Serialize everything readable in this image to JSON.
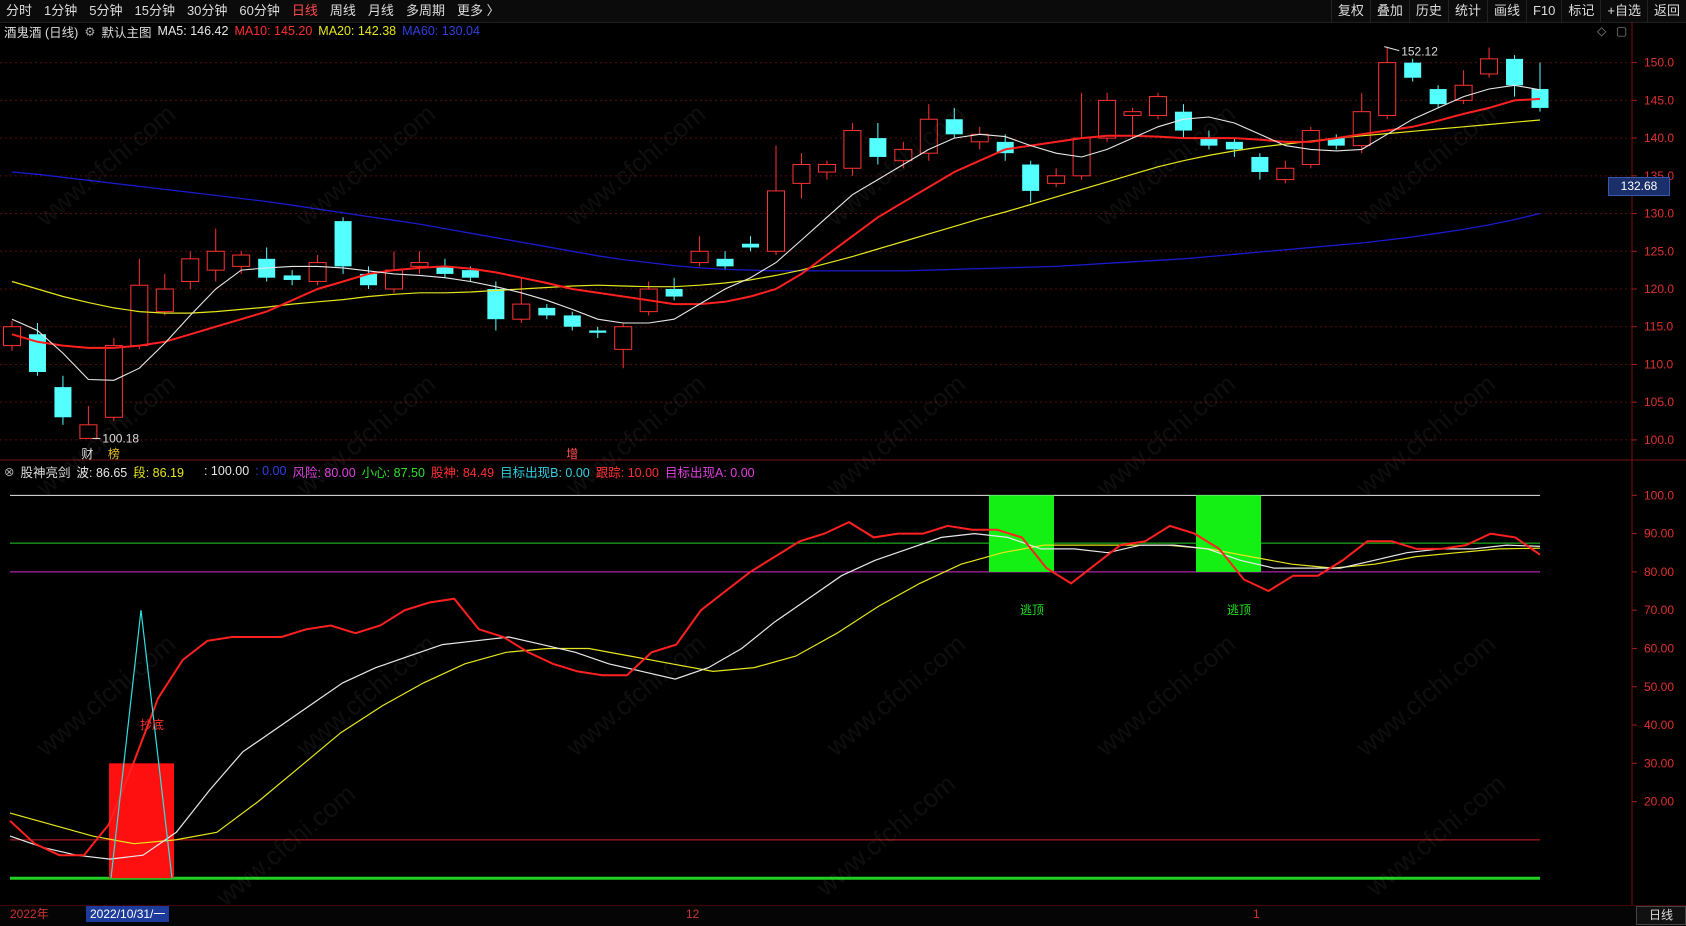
{
  "toolbar": {
    "tabs": [
      "分时",
      "1分钟",
      "5分钟",
      "15分钟",
      "30分钟",
      "60分钟",
      "日线",
      "周线",
      "月线",
      "多周期",
      "更多 〉"
    ],
    "active_tab": "日线",
    "tools": [
      "复权",
      "叠加",
      "历史",
      "统计",
      "画线",
      "F10",
      "标记",
      "+自选",
      "返回"
    ]
  },
  "main_legend": {
    "stock": "酒鬼酒 (日线)",
    "template": "默认主图",
    "ma5": "MA5: 146.42",
    "ma10": "MA10: 145.20",
    "ma20": "MA20: 142.38",
    "ma60": "MA60: 130.04"
  },
  "sub_legend": {
    "name": "股神亮剑",
    "bo": "波: 86.65",
    "duan": "段: 86.19",
    "v100": ": 100.00",
    "v0": ": 0.00",
    "fengxian": "风险: 80.00",
    "xiaoxin": "小心: 87.50",
    "gushen": "股神: 84.49",
    "mubiaoB": "目标出现B: 0.00",
    "genzong": "跟踪: 10.00",
    "mubiaoA": "目标出现A: 0.00"
  },
  "price_axis": [
    "150.0",
    "145.0",
    "140.0",
    "135.0",
    "130.0",
    "125.0",
    "120.0",
    "115.0",
    "110.0",
    "105.0",
    "100.0"
  ],
  "ind_axis": [
    "100.0",
    "90.00",
    "80.00",
    "70.00",
    "60.00",
    "50.00",
    "40.00",
    "30.00",
    "20.00"
  ],
  "current_price": "132.68",
  "high_label": "152.12",
  "low_label": "100.18",
  "markers": {
    "cai": "财",
    "bang": "榜",
    "zeng": "增",
    "chaodi": "抄底",
    "taoding1": "逃顶",
    "taoding2": "逃顶"
  },
  "watermark": "www.cfchi.com",
  "bottom": {
    "year": "2022年",
    "date": "2022/10/31/一",
    "m12": "12",
    "m1": "1",
    "day_button": "日线"
  },
  "colors": {
    "up": "#ff3232",
    "down": "#54ffff",
    "ma5": "#e8e8e8",
    "ma10": "#ff2020",
    "ma20": "#e6e61e",
    "ma60": "#1a1acc"
  },
  "chart_data": {
    "type": "candlestick",
    "title": "酒鬼酒 (日线)",
    "ylim": [
      98,
      153
    ],
    "candles": [
      {
        "o": 112.5,
        "c": 115.0,
        "h": 115.8,
        "l": 111.8
      },
      {
        "o": 114.0,
        "c": 109.0,
        "h": 115.5,
        "l": 108.5
      },
      {
        "o": 107.0,
        "c": 103.0,
        "h": 108.5,
        "l": 102.0
      },
      {
        "o": 100.2,
        "c": 102.0,
        "h": 104.5,
        "l": 100.18
      },
      {
        "o": 103.0,
        "c": 112.5,
        "h": 113.5,
        "l": 102.5
      },
      {
        "o": 112.5,
        "c": 120.5,
        "h": 124.0,
        "l": 112.0
      },
      {
        "o": 117.0,
        "c": 120.0,
        "h": 122.0,
        "l": 116.5
      },
      {
        "o": 121.0,
        "c": 124.0,
        "h": 125.0,
        "l": 120.0
      },
      {
        "o": 122.5,
        "c": 125.0,
        "h": 128.0,
        "l": 121.0
      },
      {
        "o": 123.0,
        "c": 124.5,
        "h": 125.0,
        "l": 122.0
      },
      {
        "o": 124.0,
        "c": 121.5,
        "h": 125.5,
        "l": 121.0
      },
      {
        "o": 121.8,
        "c": 121.2,
        "h": 122.5,
        "l": 120.5
      },
      {
        "o": 121.0,
        "c": 123.5,
        "h": 124.5,
        "l": 120.5
      },
      {
        "o": 129.0,
        "c": 123.0,
        "h": 129.5,
        "l": 122.0
      },
      {
        "o": 122.0,
        "c": 120.5,
        "h": 123.0,
        "l": 120.0
      },
      {
        "o": 120.0,
        "c": 122.5,
        "h": 125.0,
        "l": 119.5
      },
      {
        "o": 123.0,
        "c": 123.5,
        "h": 125.0,
        "l": 122.0
      },
      {
        "o": 123.0,
        "c": 122.0,
        "h": 124.0,
        "l": 121.5
      },
      {
        "o": 122.5,
        "c": 121.5,
        "h": 123.0,
        "l": 121.0
      },
      {
        "o": 120.0,
        "c": 116.0,
        "h": 121.0,
        "l": 114.5
      },
      {
        "o": 116.0,
        "c": 118.0,
        "h": 121.5,
        "l": 115.5
      },
      {
        "o": 117.5,
        "c": 116.5,
        "h": 118.0,
        "l": 116.0
      },
      {
        "o": 116.5,
        "c": 115.0,
        "h": 117.0,
        "l": 114.5
      },
      {
        "o": 114.5,
        "c": 114.2,
        "h": 115.0,
        "l": 113.5
      },
      {
        "o": 112.0,
        "c": 115.0,
        "h": 115.5,
        "l": 109.5
      },
      {
        "o": 117.0,
        "c": 120.0,
        "h": 121.0,
        "l": 116.5
      },
      {
        "o": 120.0,
        "c": 119.0,
        "h": 121.5,
        "l": 118.5
      },
      {
        "o": 123.5,
        "c": 125.0,
        "h": 127.0,
        "l": 123.0
      },
      {
        "o": 124.0,
        "c": 123.0,
        "h": 125.0,
        "l": 122.5
      },
      {
        "o": 126.0,
        "c": 125.5,
        "h": 127.0,
        "l": 125.0
      },
      {
        "o": 125.0,
        "c": 133.0,
        "h": 139.0,
        "l": 124.5
      },
      {
        "o": 134.0,
        "c": 136.5,
        "h": 138.0,
        "l": 132.0
      },
      {
        "o": 135.5,
        "c": 136.5,
        "h": 137.0,
        "l": 134.5
      },
      {
        "o": 136.0,
        "c": 141.0,
        "h": 142.0,
        "l": 135.0
      },
      {
        "o": 140.0,
        "c": 137.5,
        "h": 142.0,
        "l": 136.5
      },
      {
        "o": 137.0,
        "c": 138.5,
        "h": 139.5,
        "l": 136.0
      },
      {
        "o": 138.0,
        "c": 142.5,
        "h": 144.5,
        "l": 137.0
      },
      {
        "o": 142.5,
        "c": 140.5,
        "h": 144.0,
        "l": 140.0
      },
      {
        "o": 139.5,
        "c": 140.5,
        "h": 141.5,
        "l": 138.5
      },
      {
        "o": 139.5,
        "c": 138.0,
        "h": 140.5,
        "l": 137.0
      },
      {
        "o": 136.5,
        "c": 133.0,
        "h": 137.0,
        "l": 131.5
      },
      {
        "o": 134.0,
        "c": 135.0,
        "h": 136.0,
        "l": 133.5
      },
      {
        "o": 135.0,
        "c": 140.0,
        "h": 146.0,
        "l": 134.5
      },
      {
        "o": 140.0,
        "c": 145.0,
        "h": 146.0,
        "l": 139.5
      },
      {
        "o": 143.0,
        "c": 143.5,
        "h": 144.0,
        "l": 140.0
      },
      {
        "o": 143.0,
        "c": 145.5,
        "h": 146.0,
        "l": 142.5
      },
      {
        "o": 143.5,
        "c": 141.0,
        "h": 144.5,
        "l": 140.0
      },
      {
        "o": 140.0,
        "c": 139.0,
        "h": 141.0,
        "l": 138.5
      },
      {
        "o": 139.5,
        "c": 138.5,
        "h": 140.0,
        "l": 137.5
      },
      {
        "o": 137.5,
        "c": 135.5,
        "h": 138.0,
        "l": 134.5
      },
      {
        "o": 134.5,
        "c": 136.0,
        "h": 137.0,
        "l": 134.0
      },
      {
        "o": 136.5,
        "c": 141.0,
        "h": 141.5,
        "l": 136.0
      },
      {
        "o": 140.0,
        "c": 139.0,
        "h": 140.5,
        "l": 138.5
      },
      {
        "o": 139.0,
        "c": 143.5,
        "h": 146.0,
        "l": 138.0
      },
      {
        "o": 143.0,
        "c": 150.0,
        "h": 152.12,
        "l": 142.5
      },
      {
        "o": 150.0,
        "c": 148.0,
        "h": 150.5,
        "l": 147.5
      },
      {
        "o": 146.5,
        "c": 144.5,
        "h": 147.0,
        "l": 144.0
      },
      {
        "o": 145.0,
        "c": 147.0,
        "h": 149.0,
        "l": 144.5
      },
      {
        "o": 148.5,
        "c": 150.5,
        "h": 152.0,
        "l": 148.0
      },
      {
        "o": 150.5,
        "c": 147.0,
        "h": 151.0,
        "l": 145.5
      },
      {
        "o": 146.5,
        "c": 144.0,
        "h": 150.0,
        "l": 143.5
      }
    ],
    "ma5": [
      116.0,
      114.5,
      111.5,
      108.0,
      107.9,
      109.5,
      112.8,
      116.5,
      120.0,
      122.5,
      122.8,
      123.0,
      123.0,
      122.8,
      122.4,
      122.0,
      121.8,
      121.5,
      121.0,
      120.3,
      119.5,
      118.5,
      117.3,
      116.0,
      115.5,
      115.5,
      116.0,
      118.0,
      120.0,
      121.5,
      123.5,
      126.5,
      129.5,
      132.5,
      134.5,
      136.5,
      138.5,
      140.0,
      140.5,
      140.2,
      139.0,
      138.0,
      137.5,
      138.5,
      140.0,
      141.5,
      142.5,
      142.8,
      142.0,
      140.5,
      139.0,
      138.5,
      138.3,
      138.5,
      140.5,
      142.5,
      144.0,
      145.5,
      146.5,
      147.0,
      146.4
    ],
    "ma10": [
      114.0,
      113.0,
      112.5,
      112.2,
      112.2,
      112.5,
      113.0,
      114.0,
      115.0,
      116.0,
      117.0,
      118.5,
      120.0,
      121.0,
      122.0,
      122.5,
      122.8,
      123.0,
      122.7,
      122.2,
      121.5,
      120.8,
      120.0,
      119.5,
      119.0,
      118.5,
      118.0,
      118.0,
      118.3,
      119.0,
      120.0,
      122.0,
      124.5,
      127.0,
      129.5,
      131.5,
      133.5,
      135.5,
      137.0,
      138.5,
      139.0,
      139.5,
      140.0,
      140.3,
      140.3,
      140.2,
      140.0,
      140.0,
      140.0,
      139.8,
      139.5,
      139.5,
      140.0,
      140.5,
      141.0,
      141.5,
      142.3,
      143.2,
      144.0,
      145.0,
      145.2
    ],
    "ma20": [
      121.0,
      120.0,
      119.0,
      118.2,
      117.5,
      117.0,
      116.8,
      116.8,
      117.0,
      117.3,
      117.6,
      118.0,
      118.3,
      118.6,
      119.0,
      119.3,
      119.5,
      119.5,
      119.6,
      119.8,
      120.0,
      120.2,
      120.4,
      120.5,
      120.4,
      120.3,
      120.3,
      120.5,
      120.8,
      121.2,
      121.8,
      122.5,
      123.4,
      124.3,
      125.3,
      126.3,
      127.3,
      128.3,
      129.3,
      130.2,
      131.2,
      132.2,
      133.2,
      134.2,
      135.2,
      136.2,
      137.0,
      137.7,
      138.3,
      138.8,
      139.2,
      139.6,
      140.0,
      140.3,
      140.6,
      140.9,
      141.2,
      141.5,
      141.8,
      142.1,
      142.4
    ],
    "ma60": [
      135.5,
      135.2,
      134.8,
      134.4,
      134.0,
      133.6,
      133.2,
      132.8,
      132.4,
      132.0,
      131.6,
      131.1,
      130.6,
      130.1,
      129.6,
      129.1,
      128.6,
      128.0,
      127.4,
      126.8,
      126.2,
      125.6,
      125.0,
      124.4,
      123.9,
      123.5,
      123.1,
      122.8,
      122.6,
      122.5,
      122.4,
      122.4,
      122.4,
      122.4,
      122.4,
      122.4,
      122.5,
      122.6,
      122.7,
      122.8,
      122.9,
      123.0,
      123.2,
      123.4,
      123.6,
      123.8,
      124.0,
      124.3,
      124.6,
      124.9,
      125.2,
      125.5,
      125.8,
      126.1,
      126.5,
      126.9,
      127.4,
      127.9,
      128.5,
      129.2,
      130.0
    ],
    "ind_ylim": [
      -7,
      104
    ],
    "gushen": [
      15,
      9,
      6,
      6,
      14,
      30,
      47,
      57,
      62,
      63,
      63,
      63,
      65,
      66,
      64,
      66,
      70,
      72,
      73,
      65,
      63,
      59,
      56,
      54,
      53,
      53,
      59,
      61,
      70,
      75,
      80,
      84,
      88,
      90,
      93,
      89,
      90,
      90,
      92,
      91,
      91,
      89,
      81,
      77,
      82,
      87,
      88,
      92,
      90,
      86,
      78,
      75,
      79,
      79,
      83,
      88,
      88,
      86,
      86,
      87,
      90,
      89,
      84.49
    ],
    "bo": [
      11,
      8,
      6,
      5,
      6,
      12,
      23,
      33,
      39,
      45,
      51,
      55,
      58,
      61,
      62,
      63,
      61,
      59,
      56,
      54,
      52,
      55,
      60,
      67,
      73,
      79,
      83,
      86,
      89,
      90,
      89,
      86,
      86,
      85,
      87,
      87,
      86,
      83,
      81,
      81,
      81,
      83,
      85,
      86,
      86,
      87,
      86.65
    ],
    "duan": [
      17,
      14,
      11,
      9,
      10,
      12,
      20,
      29,
      38,
      45,
      51,
      56,
      59,
      60,
      60,
      58,
      56,
      54,
      55,
      58,
      64,
      71,
      77,
      82,
      85,
      87,
      87,
      87,
      87,
      86,
      84,
      82,
      81,
      82,
      84,
      85,
      86,
      86.19
    ],
    "chaodi_spike": 70,
    "levels": {
      "top": 100,
      "xiaoxin": 87.5,
      "fengxian": 80,
      "genzong": 10,
      "zero": 0
    }
  }
}
